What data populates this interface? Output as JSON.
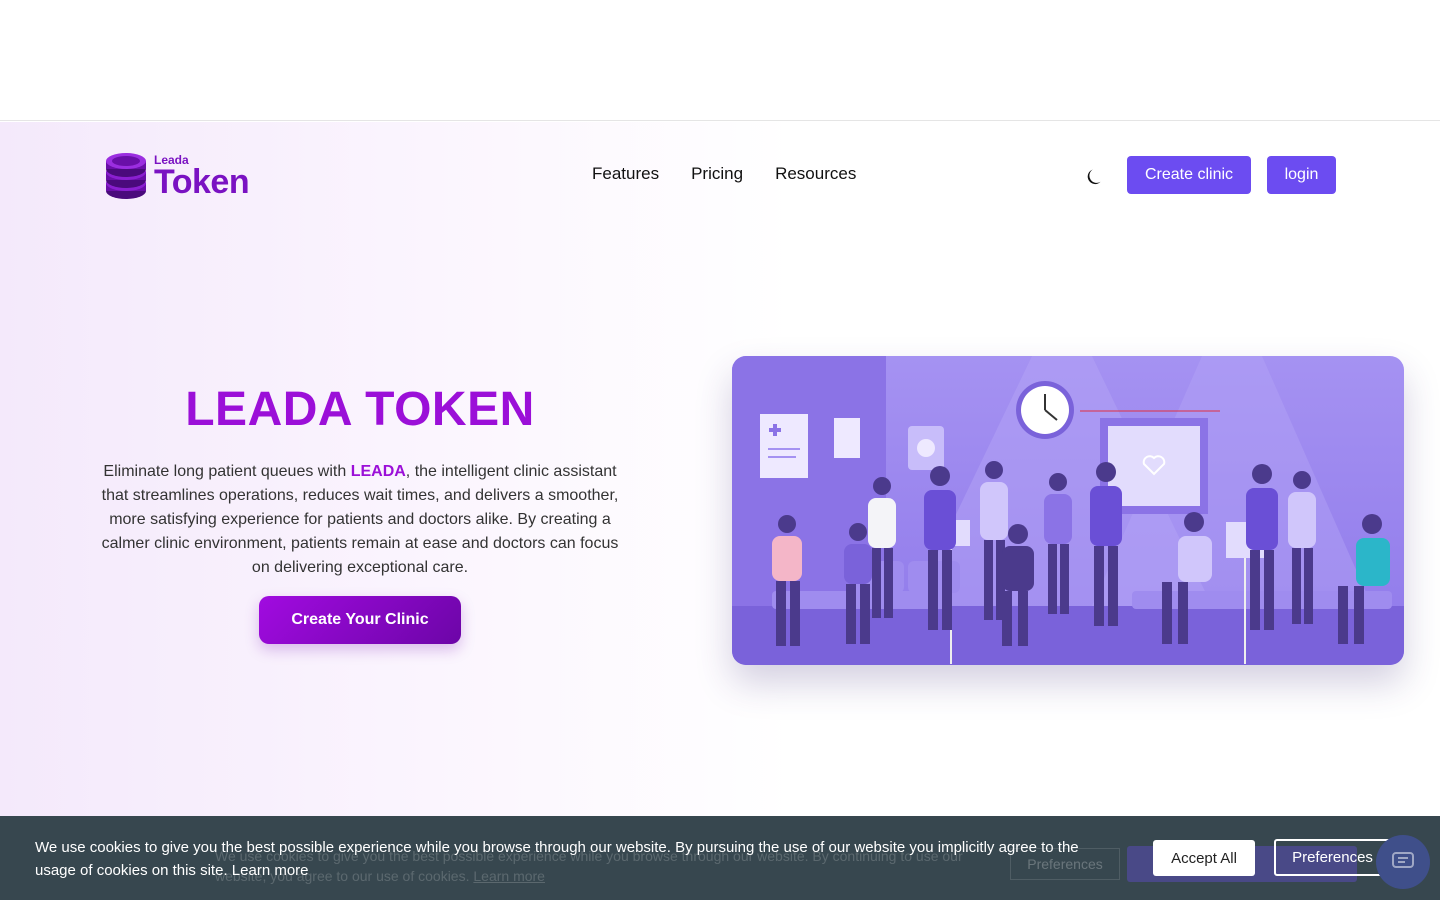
{
  "brand": {
    "small": "Leada",
    "big": "Token",
    "logo_color": "#7a12c2"
  },
  "nav": {
    "links": [
      "Features",
      "Pricing",
      "Resources"
    ],
    "theme_icon": "moon-icon",
    "create_clinic_label": "Create clinic",
    "login_label": "login",
    "button_color": "#6c4cf1"
  },
  "hero": {
    "title": "LEADA TOKEN",
    "text_before": "Eliminate long patient queues with ",
    "text_highlight": "LEADA",
    "text_after": ", the intelligent clinic assistant that streamlines operations, reduces wait times, and delivers a smoother, more satisfying experience for patients and doctors alike. By creating a calmer clinic environment, patients remain at ease and doctors can focus on delivering exceptional care.",
    "cta_label": "Create Your Clinic",
    "accent_color": "#9b0fd8",
    "image": "clinic-waiting-room-illustration"
  },
  "cookie": {
    "text": "We use cookies to give you the best possible experience while you browse through our website. By pursuing the use of our website you implicitly agree to the usage of cookies on this site.",
    "learn_more": "Learn more",
    "accept_label": "Accept All",
    "preferences_label": "Preferences",
    "ghost_text": "We use cookies to give you the best possible experience while you browse through our website. By continuing to use our website, you agree to our use of cookies.",
    "ghost_learn_more": "Learn more",
    "ghost_preferences": "Preferences",
    "chat_icon": "chat-icon",
    "bar_color": "#37474f"
  }
}
